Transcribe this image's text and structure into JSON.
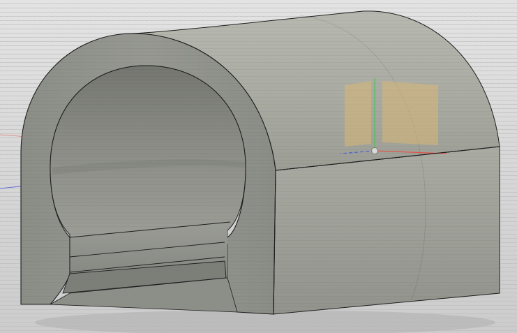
{
  "app": {
    "view": "3d-model-viewport"
  },
  "scene": {
    "model": "arched-tunnel-bracket",
    "colors": {
      "background_top": "#e3e3e3",
      "background_bottom": "#cccccc",
      "scanline": "#bdbdbd",
      "arch_top_light": "#b4b6ac",
      "arch_top_dark": "#9a9c93",
      "side_light": "#a8aaa2",
      "side_dark": "#8e9089",
      "front_face": "#8f918b",
      "inner_shadow": "#7a7c76",
      "edge": "#1e1e1e",
      "ground_grid": "#c4c4c4",
      "ground_shadow": "#b7b7b7",
      "axis_x": "#e0534a",
      "axis_y": "#4fbf5a",
      "axis_z": "#4b5bd6",
      "origin_plane": "#d9b777",
      "origin_point": "#d8d8d8"
    },
    "icons": {
      "origin": "origin-point-icon",
      "planes": "origin-plane-icon"
    }
  }
}
